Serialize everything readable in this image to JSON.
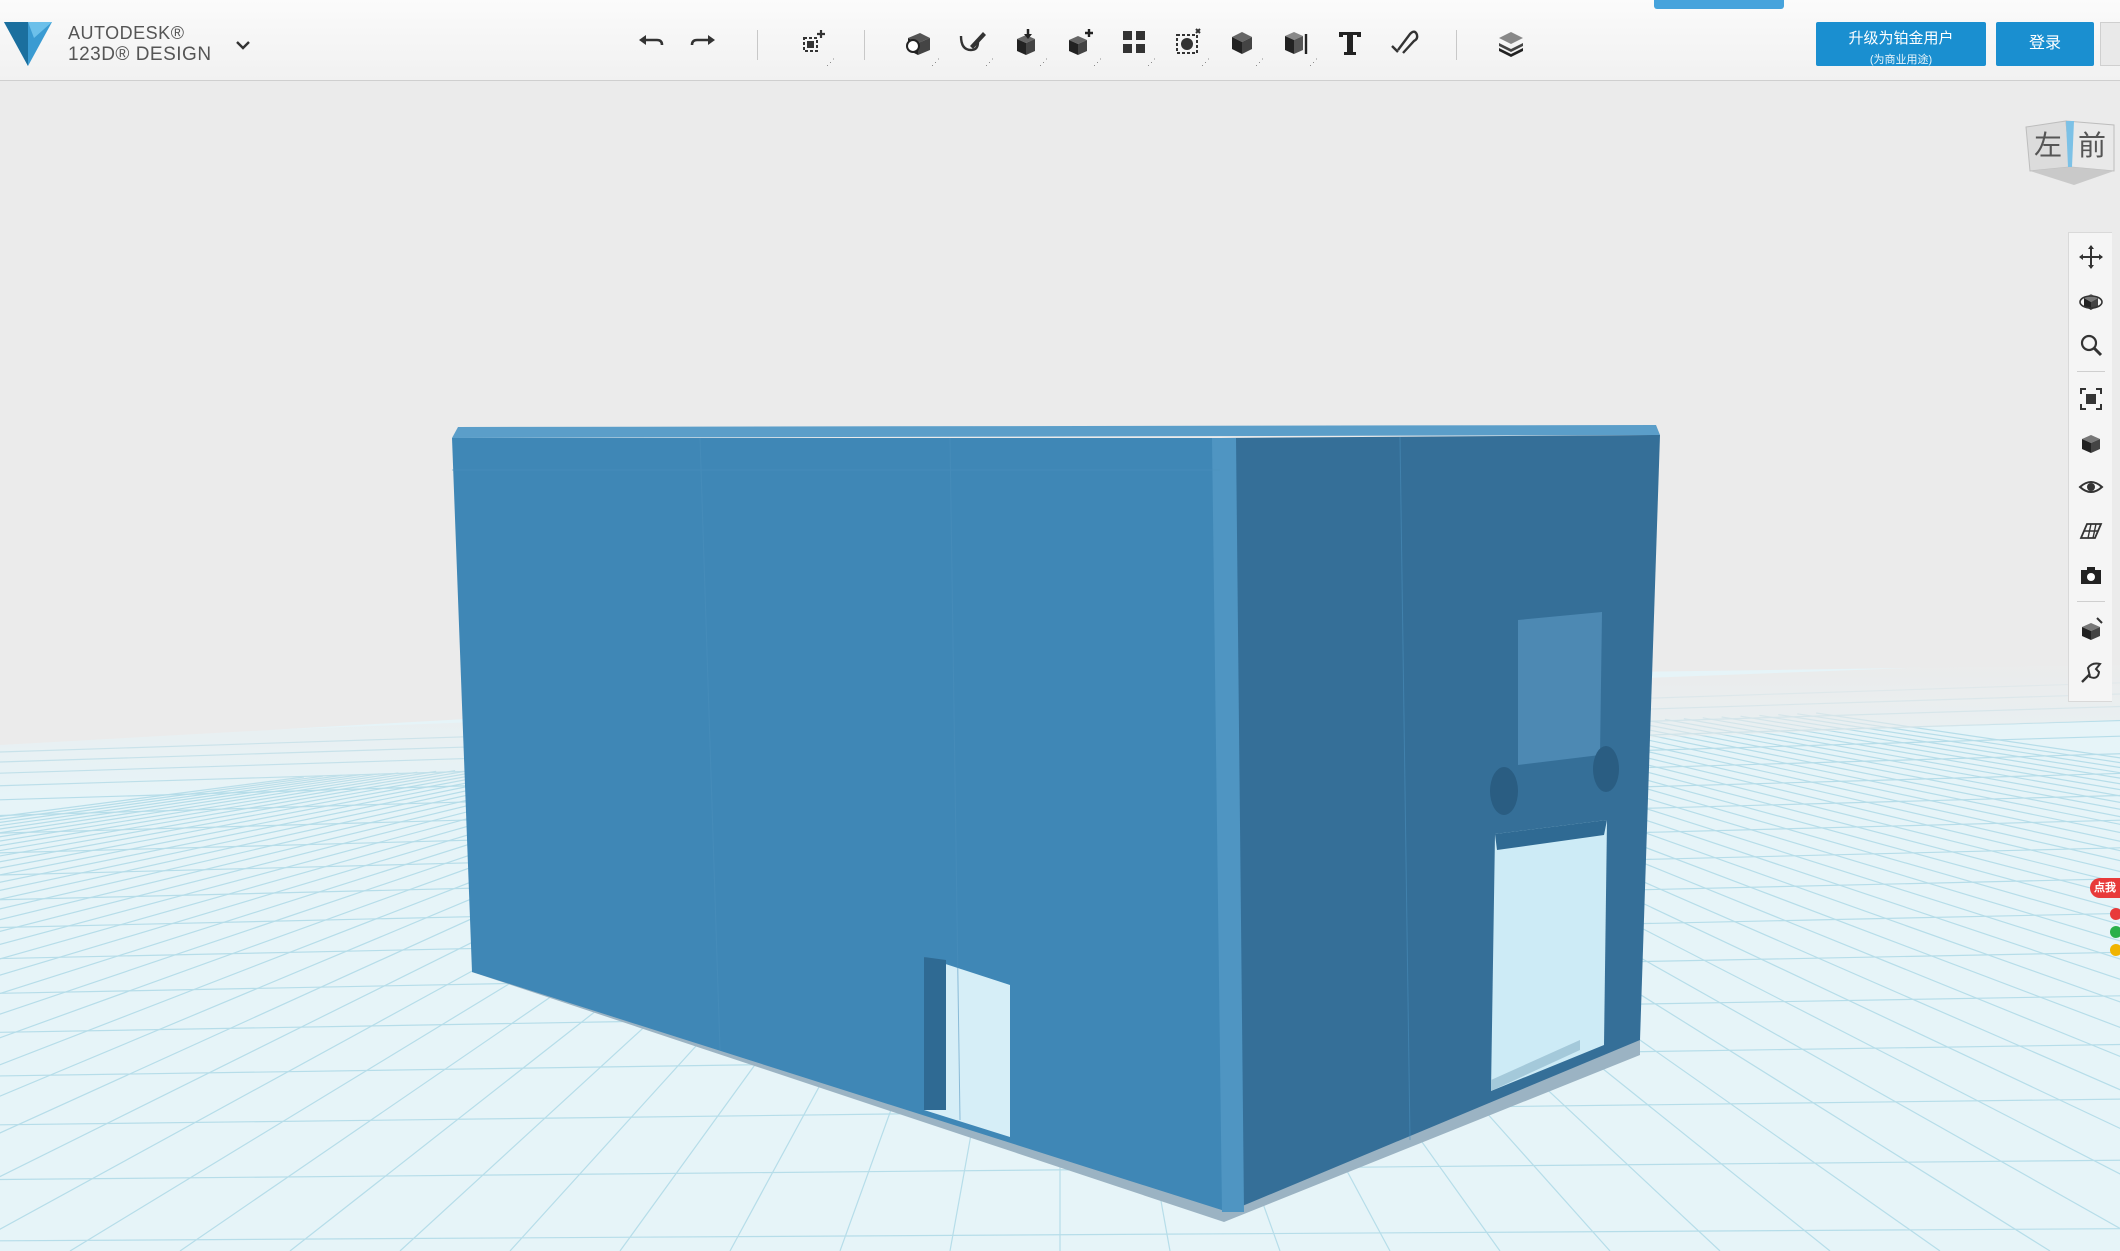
{
  "app": {
    "brand_line1": "AUTODESK®",
    "brand_line2": "123D® DESIGN"
  },
  "toolbar": {
    "items": [
      {
        "name": "undo-button",
        "icon": "undo-icon"
      },
      {
        "name": "redo-button",
        "icon": "redo-icon"
      },
      {
        "name": "transform-button",
        "icon": "transform-icon"
      },
      {
        "name": "primitives-button",
        "icon": "primitives-icon"
      },
      {
        "name": "sketch-button",
        "icon": "sketch-icon"
      },
      {
        "name": "construct-button",
        "icon": "construct-icon"
      },
      {
        "name": "modify-button",
        "icon": "modify-icon"
      },
      {
        "name": "pattern-button",
        "icon": "pattern-icon"
      },
      {
        "name": "grouping-button",
        "icon": "grouping-icon"
      },
      {
        "name": "combine-button",
        "icon": "combine-icon"
      },
      {
        "name": "measure-button",
        "icon": "measure-icon"
      },
      {
        "name": "text-button",
        "icon": "text-icon",
        "label": "T"
      },
      {
        "name": "snap-button",
        "icon": "snap-icon"
      },
      {
        "name": "material-button",
        "icon": "material-icon"
      }
    ]
  },
  "account": {
    "upgrade_label": "升级为铂金用户",
    "upgrade_sub": "(为商业用途)",
    "login_label": "登录"
  },
  "viewcube": {
    "face_left": "左",
    "face_front": "前"
  },
  "nav": {
    "items": [
      "pan-icon",
      "orbit-icon",
      "zoom-icon",
      "fit-icon",
      "views-icon",
      "visibility-icon",
      "grid-icon",
      "camera-icon",
      "material-icon",
      "settings-icon"
    ]
  },
  "side_badge": "点我",
  "colors": {
    "accent": "#1a8fd0",
    "model": "#3f86b5",
    "grid": "#bfe4f0"
  }
}
